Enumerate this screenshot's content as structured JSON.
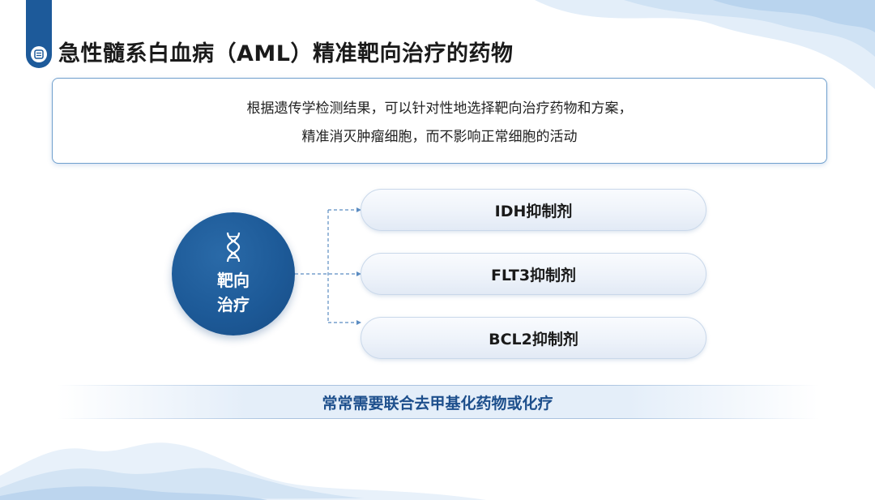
{
  "title": "急性髓系白血病（AML）精准靶向治疗的药物",
  "intro": {
    "line1": "根据遗传学检测结果，可以针对性地选择靶向治疗药物和方案，",
    "line2": "精准消灭肿瘤细胞，而不影响正常细胞的活动"
  },
  "hub": {
    "icon": "dna-icon",
    "label_line1": "靶向",
    "label_line2": "治疗"
  },
  "drugs": [
    {
      "label": "IDH抑制剂"
    },
    {
      "label": "FLT3抑制剂"
    },
    {
      "label": "BCL2抑制剂"
    }
  ],
  "footer_note": "常常需要联合去甲基化药物或化疗",
  "colors": {
    "primary_blue": "#1d5a9a",
    "band_text": "#1d4f8c",
    "box_border": "#6f9fcd"
  }
}
